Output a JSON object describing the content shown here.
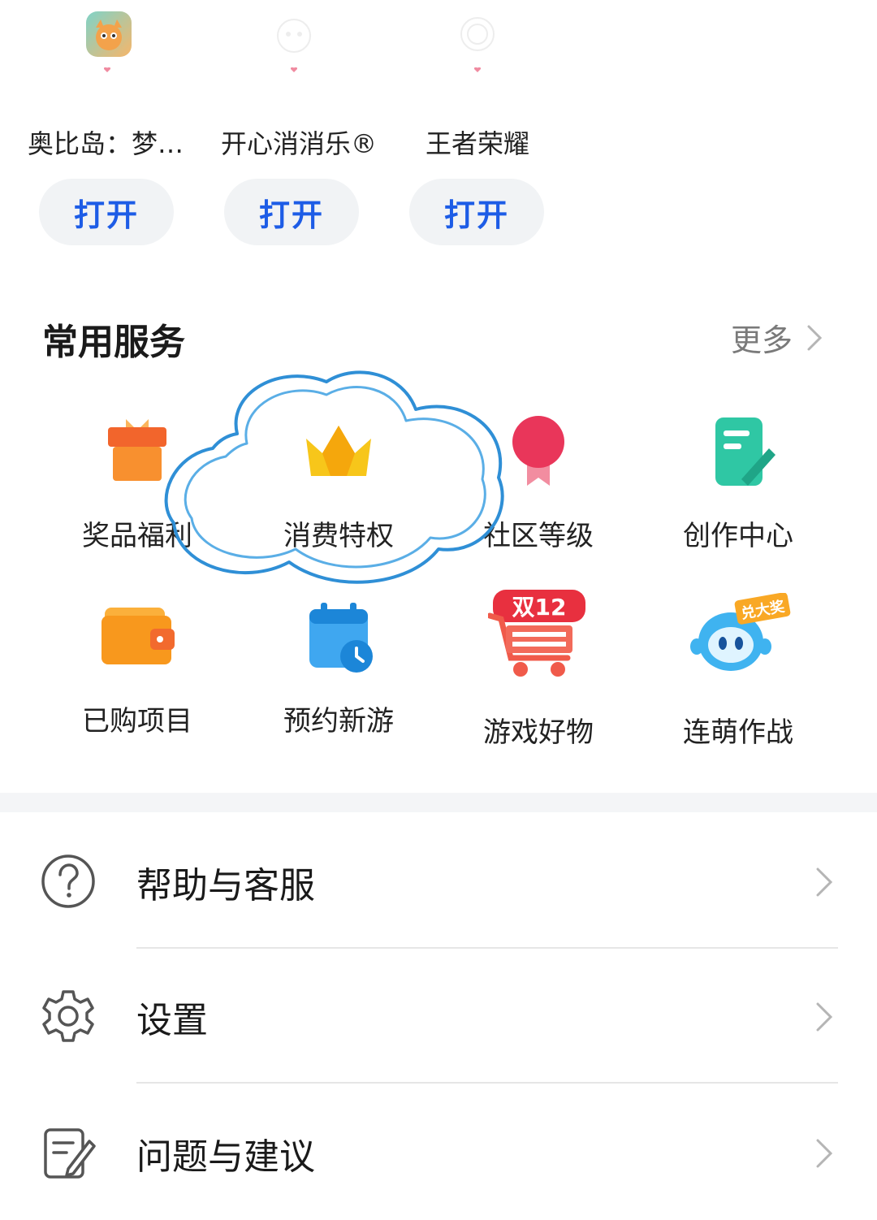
{
  "recent_games": [
    {
      "name": "奥比岛：梦…",
      "button": "打开"
    },
    {
      "name": "开心消消乐®",
      "button": "打开"
    },
    {
      "name": "王者荣耀",
      "button": "打开"
    }
  ],
  "services": {
    "title": "常用服务",
    "more": "更多",
    "items": [
      {
        "label": "奖品福利",
        "icon": "gift-icon"
      },
      {
        "label": "消费特权",
        "icon": "crown-icon"
      },
      {
        "label": "社区等级",
        "icon": "medal-icon"
      },
      {
        "label": "创作中心",
        "icon": "note-edit-icon"
      },
      {
        "label": "已购项目",
        "icon": "wallet-icon"
      },
      {
        "label": "预约新游",
        "icon": "calendar-clock-icon"
      },
      {
        "label": "游戏好物",
        "icon": "shopping-cart-icon",
        "badge": "双12"
      },
      {
        "label": "连萌作战",
        "icon": "mascot-icon",
        "badge": "兑大奖"
      }
    ]
  },
  "menu": [
    {
      "label": "帮助与客服",
      "icon": "help-icon"
    },
    {
      "label": "设置",
      "icon": "gear-icon"
    },
    {
      "label": "问题与建议",
      "icon": "feedback-icon"
    }
  ],
  "colors": {
    "accent_blue": "#1d5ce6",
    "highlight_cloud": "#2f8fd6"
  }
}
